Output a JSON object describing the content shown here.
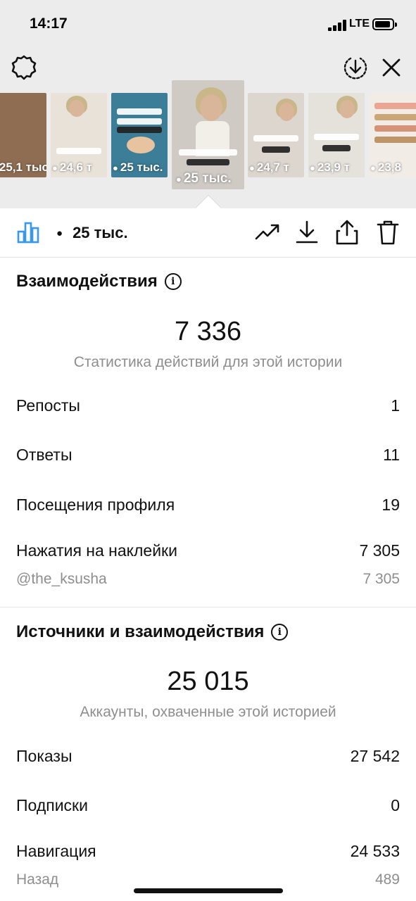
{
  "status_bar": {
    "time": "14:17",
    "network": "LTE"
  },
  "thumbnails": [
    {
      "views": "25,1 тыс.",
      "bg": "#8f6d52"
    },
    {
      "views": "24,6 т",
      "bg": "#e9e2d9"
    },
    {
      "views": "25 тыс.",
      "bg": "#3c7d98"
    },
    {
      "views": "25 тыс.",
      "bg": "#cfcac4",
      "selected": true
    },
    {
      "views": "24,7 т",
      "bg": "#ddd6cf"
    },
    {
      "views": "23,9 т",
      "bg": "#e5e2dc"
    },
    {
      "views": "23,8",
      "bg": "#f1ece6"
    }
  ],
  "toolbar": {
    "views_label": "25 тыс."
  },
  "interactions": {
    "title": "Взаимодействия",
    "total": "7 336",
    "subtitle": "Статистика действий для этой истории",
    "rows": [
      {
        "label": "Репосты",
        "value": "1"
      },
      {
        "label": "Ответы",
        "value": "11"
      },
      {
        "label": "Посещения профиля",
        "value": "19"
      },
      {
        "label": "Нажатия на наклейки",
        "value": "7 305"
      }
    ],
    "sticker_sub": {
      "label": "@the_ksusha",
      "value": "7 305"
    }
  },
  "discovery": {
    "title": "Источники и взаимодействия",
    "total": "25 015",
    "subtitle": "Аккаунты, охваченные этой историей",
    "rows": [
      {
        "label": "Показы",
        "value": "27 542"
      },
      {
        "label": "Подписки",
        "value": "0"
      },
      {
        "label": "Навигация",
        "value": "24 533"
      }
    ],
    "navigation_sub": {
      "label": "Назад",
      "value": "489"
    }
  },
  "colors": {
    "accent": "#3897f0",
    "grey_text": "#8e8e8e",
    "top_bg": "#ececec"
  }
}
